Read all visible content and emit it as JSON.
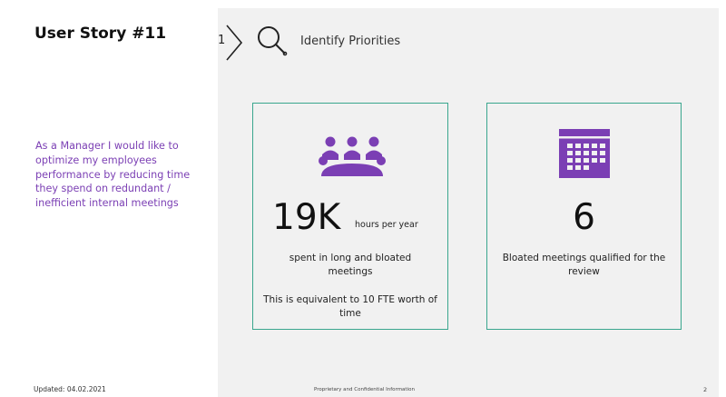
{
  "story": {
    "title": "User Story #11",
    "text": "As a Manager I would like to optimize my employees performance by reducing time they spend on redundant / inefficient internal meetings"
  },
  "step": {
    "number": "1",
    "label": "Identify Priorities"
  },
  "cards": [
    {
      "icon": "meeting-group-icon",
      "value": "19K",
      "unit": "hours per year",
      "description": "spent in long and bloated meetings",
      "note": "This is equivalent to 10 FTE worth of time"
    },
    {
      "icon": "calendar-icon",
      "value": "6",
      "description": "Bloated meetings qualified for the review"
    }
  ],
  "footer": {
    "updated": "Updated: 04.02.2021",
    "confidential": "Proprietary and Confidential Information",
    "page_number": "2"
  },
  "colors": {
    "accent_purple": "#7b3fb4",
    "card_border": "#3aa68e",
    "panel_background": "#f1f1f1"
  }
}
